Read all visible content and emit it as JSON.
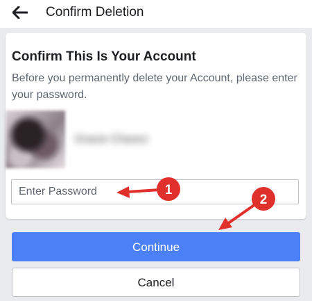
{
  "header": {
    "title": "Confirm Deletion",
    "back_icon": "arrow-left-icon"
  },
  "card": {
    "title": "Confirm This Is Your Account",
    "description": "Before you permanently delete your Account, please enter your password.",
    "profile": {
      "name": "Gracie Chavez",
      "name_blurred": true,
      "avatar_blurred": true
    },
    "password_placeholder": "Enter Password",
    "password_value": ""
  },
  "actions": {
    "continue_label": "Continue",
    "cancel_label": "Cancel"
  },
  "annotations": [
    {
      "number": "1",
      "target": "password-input"
    },
    {
      "number": "2",
      "target": "continue-button"
    }
  ],
  "colors": {
    "primary": "#4c80f6",
    "annotation_red": "#e0302c",
    "background": "#e9ebee",
    "text_dark": "#1c1e21",
    "text_secondary": "#606770"
  }
}
